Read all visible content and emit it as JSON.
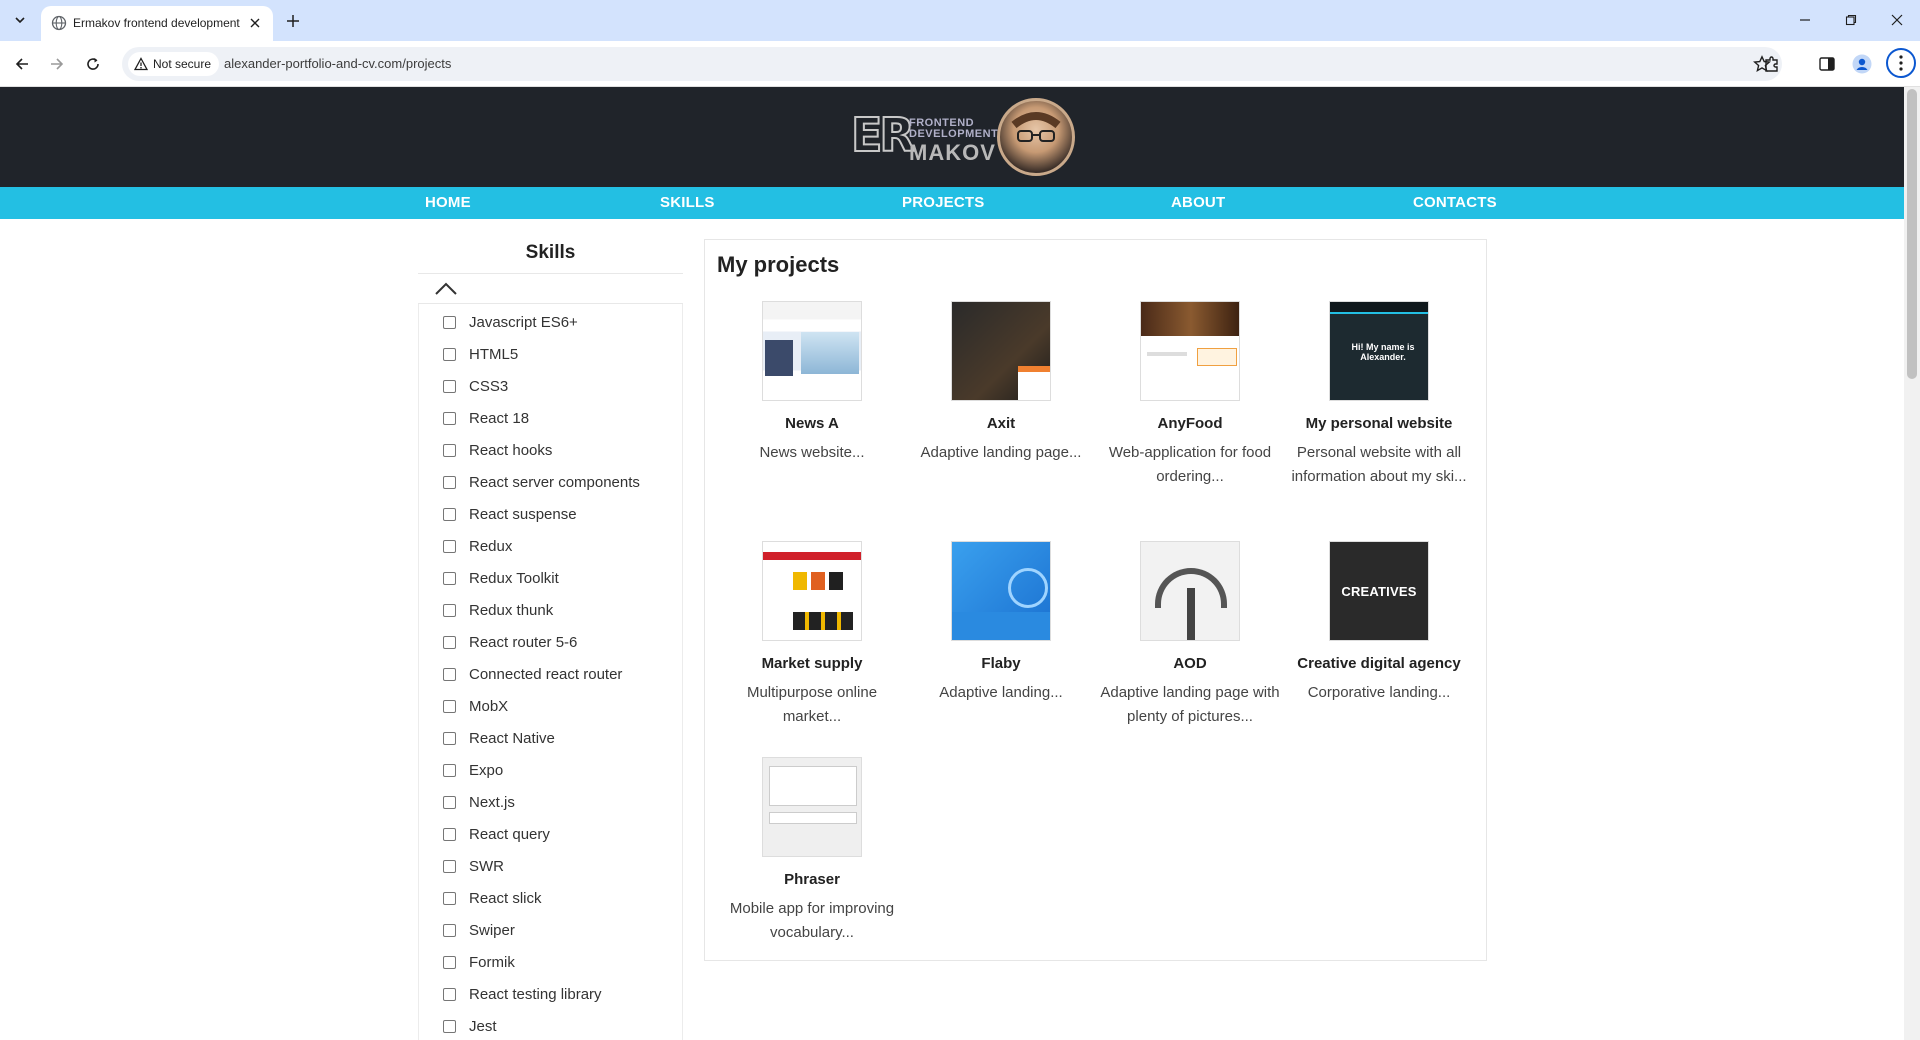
{
  "browser": {
    "tab_title": "Ermakov frontend development",
    "security_label": "Not secure",
    "url": "alexander-portfolio-and-cv.com/projects"
  },
  "site": {
    "logo": {
      "letters": "ER",
      "line1": "FRONTEND",
      "line2": "DEVELOPMENT",
      "line3": "MAKOV"
    },
    "nav": [
      "HOME",
      "SKILLS",
      "PROJECTS",
      "ABOUT",
      "CONTACTS"
    ]
  },
  "sidebar": {
    "title": "Skills",
    "skills": [
      "Javascript ES6+",
      "HTML5",
      "CSS3",
      "React 18",
      "React hooks",
      "React server components",
      "React suspense",
      "Redux",
      "Redux Toolkit",
      "Redux thunk",
      "React router 5-6",
      "Connected react router",
      "MobX",
      "React Native",
      "Expo",
      "Next.js",
      "React query",
      "SWR",
      "React slick",
      "Swiper",
      "Formik",
      "React testing library",
      "Jest"
    ]
  },
  "projects": {
    "title": "My projects",
    "items": [
      {
        "name": "News A",
        "desc": "News website..."
      },
      {
        "name": "Axit",
        "desc": "Adaptive landing page..."
      },
      {
        "name": "AnyFood",
        "desc": "Web-application for food ordering..."
      },
      {
        "name": "My personal website",
        "desc": "Personal website with all information about my ski...",
        "thumb_text": "Hi! My name is Alexander."
      },
      {
        "name": "Market supply",
        "desc": "Multipurpose online market..."
      },
      {
        "name": "Flaby",
        "desc": "Adaptive landing..."
      },
      {
        "name": "AOD",
        "desc": "Adaptive landing page with plenty of pictures..."
      },
      {
        "name": "Creative digital agency",
        "desc": "Corporative landing...",
        "thumb_text": "CREATIVES"
      },
      {
        "name": "Phraser",
        "desc": "Mobile app for improving vocabulary..."
      }
    ]
  },
  "colors": {
    "header_bg": "#20242a",
    "nav_bg": "#23bfe3",
    "tabbar_bg": "#d3e3fd"
  },
  "icons": {
    "tab_list": "chevron-down-icon",
    "back": "arrow-left-icon",
    "forward": "arrow-right-icon",
    "reload": "reload-icon",
    "warning": "warning-triangle-icon",
    "bookmark": "star-icon",
    "extensions": "puzzle-icon",
    "side_panel": "side-panel-icon",
    "profile": "profile-icon",
    "menu": "kebab-menu-icon"
  }
}
